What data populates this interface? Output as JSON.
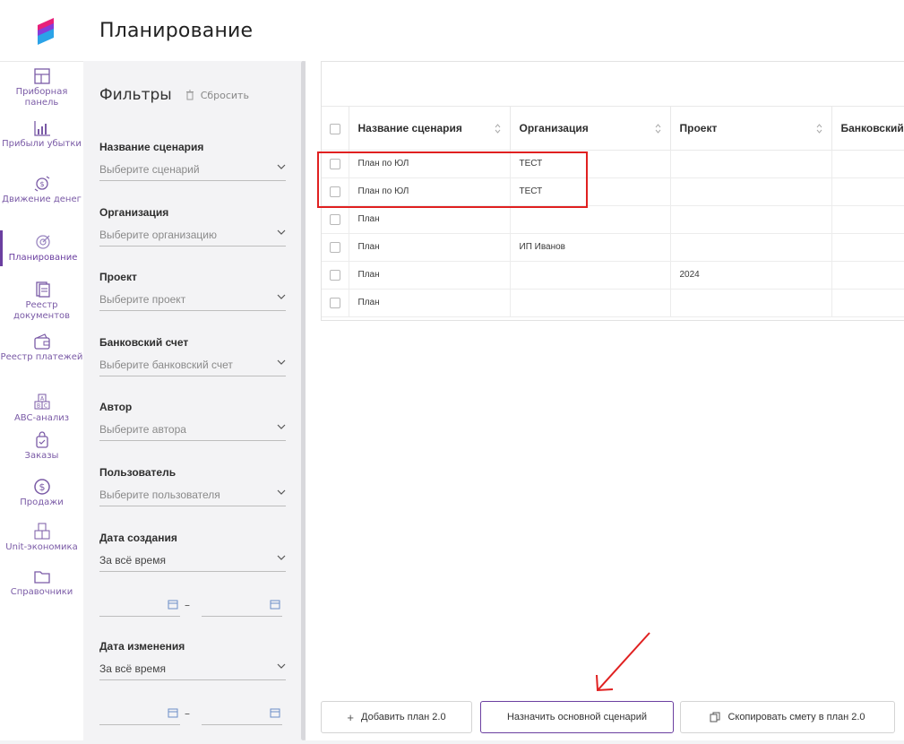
{
  "header": {
    "title": "Планирование"
  },
  "nav": {
    "items": [
      {
        "label": "Приборная панель",
        "icon": "dashboard-icon",
        "active": false
      },
      {
        "label": "Прибыли убытки",
        "icon": "bar-chart-icon",
        "active": false
      },
      {
        "label": "Движение денег",
        "icon": "cash-flow-icon",
        "active": false
      },
      {
        "label": "Планирование",
        "icon": "target-icon",
        "active": true
      },
      {
        "label": "Реестр документов",
        "icon": "documents-icon",
        "active": false
      },
      {
        "label": "Реестр платежей",
        "icon": "wallet-icon",
        "active": false
      },
      {
        "label": "ABC-анализ",
        "icon": "abc-grid-icon",
        "active": false
      },
      {
        "label": "Заказы",
        "icon": "shopping-bag-icon",
        "active": false
      },
      {
        "label": "Продажи",
        "icon": "dollar-circle-icon",
        "active": false
      },
      {
        "label": "Unit-экономика",
        "icon": "boxes-icon",
        "active": false
      },
      {
        "label": "Справочники",
        "icon": "folder-icon",
        "active": false
      }
    ]
  },
  "filters": {
    "title": "Фильтры",
    "reset_label": "Сбросить",
    "groups": [
      {
        "label": "Название сценария",
        "placeholder": "Выберите сценарий"
      },
      {
        "label": "Организация",
        "placeholder": "Выберите организацию"
      },
      {
        "label": "Проект",
        "placeholder": "Выберите проект"
      },
      {
        "label": "Банковский счет",
        "placeholder": "Выберите банковский счет"
      },
      {
        "label": "Автор",
        "placeholder": "Выберите автора"
      },
      {
        "label": "Пользователь",
        "placeholder": "Выберите пользователя"
      },
      {
        "label": "Дата создания",
        "value": "За всё время",
        "range_dash": "–"
      },
      {
        "label": "Дата изменения",
        "value": "За всё время",
        "range_dash": "–"
      }
    ]
  },
  "table": {
    "columns": [
      "Название сценария",
      "Организация",
      "Проект",
      "Банковский"
    ],
    "rows": [
      [
        "План по ЮЛ",
        "ТЕСТ",
        "",
        ""
      ],
      [
        "План по ЮЛ",
        "ТЕСТ",
        "",
        ""
      ],
      [
        "План",
        "",
        "",
        ""
      ],
      [
        "План",
        "ИП Иванов",
        "",
        ""
      ],
      [
        "План",
        "",
        "2024",
        ""
      ],
      [
        "План",
        "",
        "",
        ""
      ]
    ]
  },
  "actions": {
    "add_plan": "Добавить план 2.0",
    "add_plan_icon": "+",
    "set_main": "Назначить основной сценарий",
    "copy_estimate": "Скопировать смету в план 2.0"
  },
  "colors": {
    "accent": "#6b3fa0",
    "annotation": "#e02020",
    "panel_bg": "#f3f3f5"
  }
}
